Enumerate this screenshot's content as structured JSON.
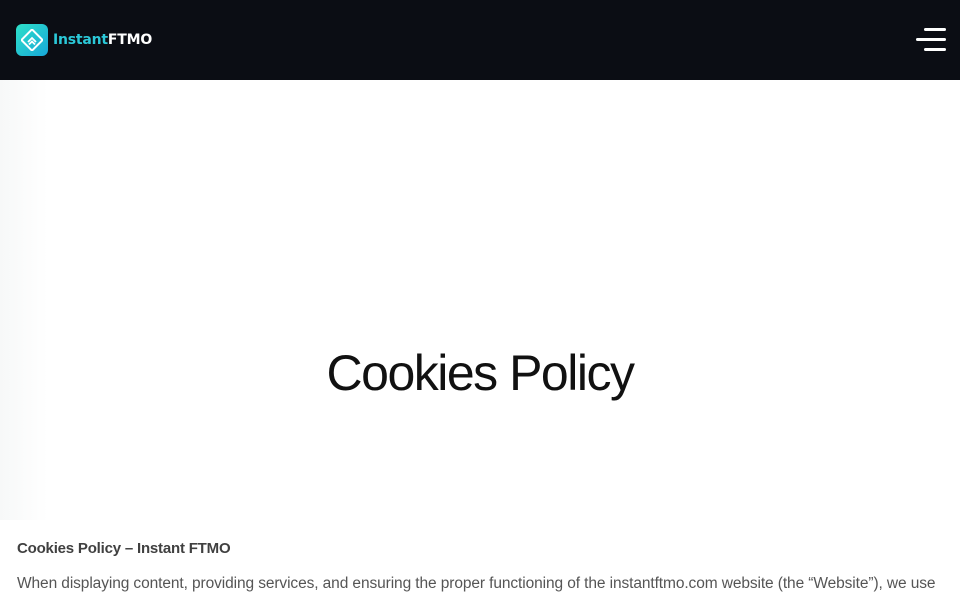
{
  "header": {
    "logo_text_part1": "Instant",
    "logo_text_part2": "FTMO",
    "logo_icon": "logo-mark-icon",
    "menu_icon": "hamburger-menu-icon",
    "background_color": "#0b0d14",
    "accent_color": "#2bc8d8"
  },
  "hero": {
    "title": "Cookies Policy"
  },
  "content": {
    "heading": "Cookies Policy – Instant FTMO",
    "paragraph": "When displaying content, providing services, and ensuring the proper functioning of the instantftmo.com website (the “Website”), we use"
  }
}
